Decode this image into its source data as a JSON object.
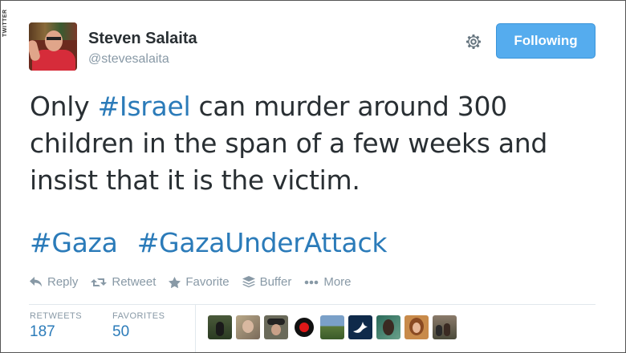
{
  "watermark": "TWITTER",
  "profile": {
    "name": "Steven Salaita",
    "handle": "@stevesalaita"
  },
  "follow_button": {
    "label": "Following"
  },
  "tweet": {
    "line1_pre": "Only ",
    "line1_tag": "#Israel",
    "line1_post": " can murder around 300",
    "line2": "children in the span of a few weeks and",
    "line3": "insist that it is the victim.",
    "hashtags": [
      "#Gaza",
      "#GazaUnderAttack"
    ]
  },
  "actions": [
    {
      "label": "Reply",
      "icon": "reply-icon"
    },
    {
      "label": "Retweet",
      "icon": "retweet-icon"
    },
    {
      "label": "Favorite",
      "icon": "star-icon"
    },
    {
      "label": "Buffer",
      "icon": "buffer-icon"
    },
    {
      "label": "More",
      "icon": "more-icon"
    }
  ],
  "stats": {
    "retweets_label": "RETWEETS",
    "retweets_value": "187",
    "favorites_label": "FAVORITES",
    "favorites_value": "50"
  },
  "colors": {
    "accent": "#55acee",
    "link": "#2b7bb9",
    "muted": "#8899a6",
    "text": "#292f33"
  }
}
